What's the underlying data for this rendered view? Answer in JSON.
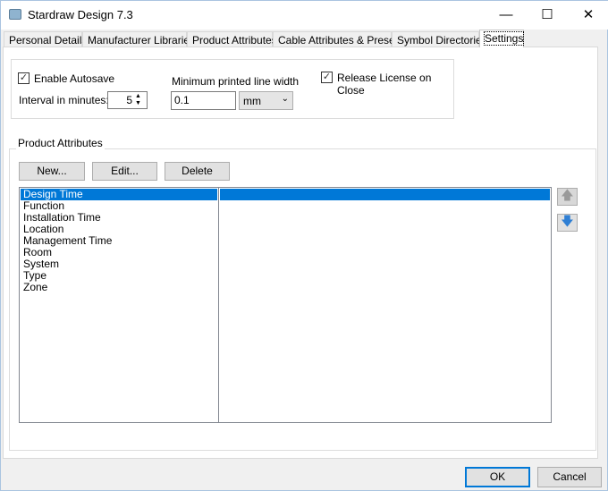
{
  "window": {
    "title": "Stardraw Design 7.3",
    "minimize": "—",
    "maximize": "☐",
    "close": "✕"
  },
  "tabs": [
    "Personal Details",
    "Manufacturer Libraries",
    "Product Attributes",
    "Cable Attributes & Presets",
    "Symbol Directories",
    "Settings"
  ],
  "active_tab": "Settings",
  "settings": {
    "enable_autosave_label": "Enable Autosave",
    "enable_autosave_checked": true,
    "interval_label": "Interval in minutes:",
    "interval_value": "5",
    "min_line_width_label": "Minimum printed line width",
    "min_line_width_value": "0.1",
    "unit_value": "mm",
    "release_license_label": "Release License on Close",
    "release_license_checked": true
  },
  "product_attributes": {
    "group_label": "Product Attributes",
    "new_label": "New...",
    "edit_label": "Edit...",
    "delete_label": "Delete",
    "items": [
      "Design Time",
      "Function",
      "Installation Time",
      "Location",
      "Management Time",
      "Room",
      "System",
      "Type",
      "Zone"
    ],
    "selected": "Design Time",
    "accent": "#0078d7"
  },
  "footer": {
    "ok_label": "OK",
    "cancel_label": "Cancel"
  }
}
